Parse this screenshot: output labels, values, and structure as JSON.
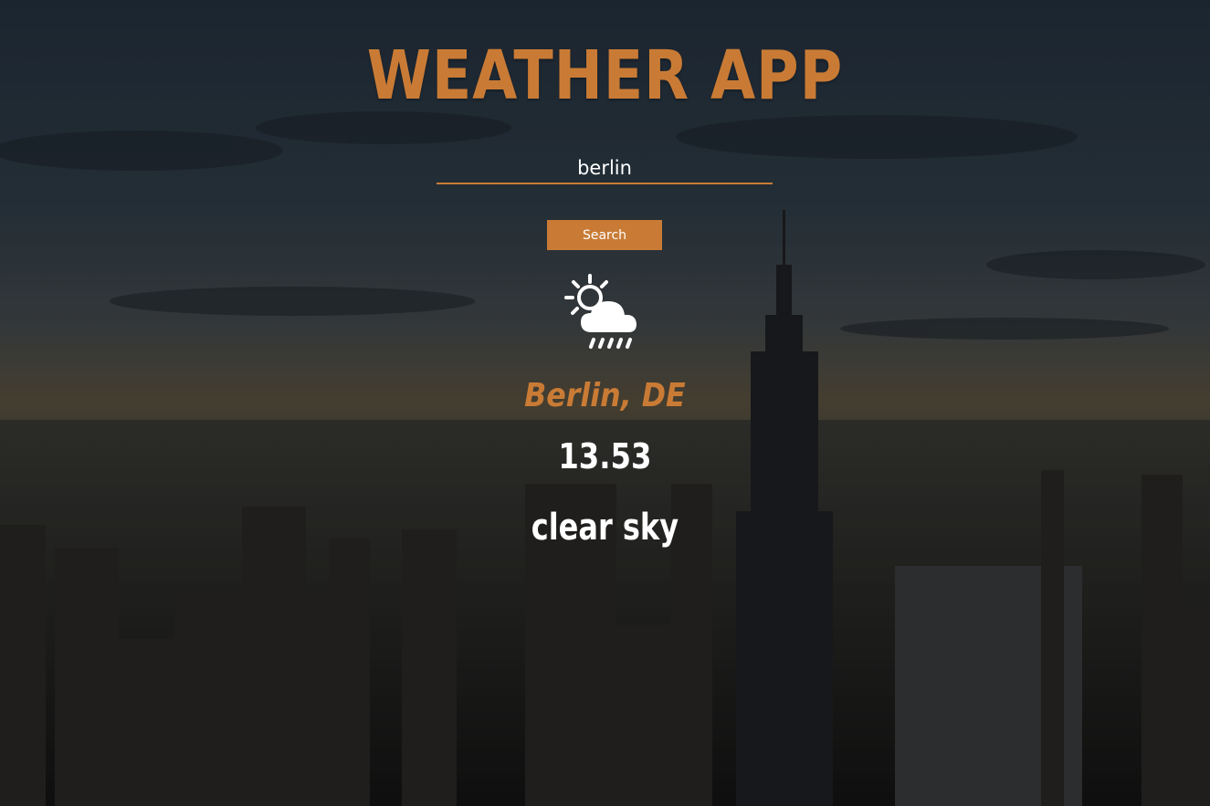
{
  "app": {
    "title": "WEATHER APP"
  },
  "search": {
    "value": "berlin",
    "button_label": "Search"
  },
  "weather": {
    "icon": "sun-cloud-rain-icon",
    "location": "Berlin, DE",
    "temperature": "13.53",
    "description": "clear sky"
  },
  "colors": {
    "accent": "#c97b35",
    "text": "#ffffff"
  }
}
